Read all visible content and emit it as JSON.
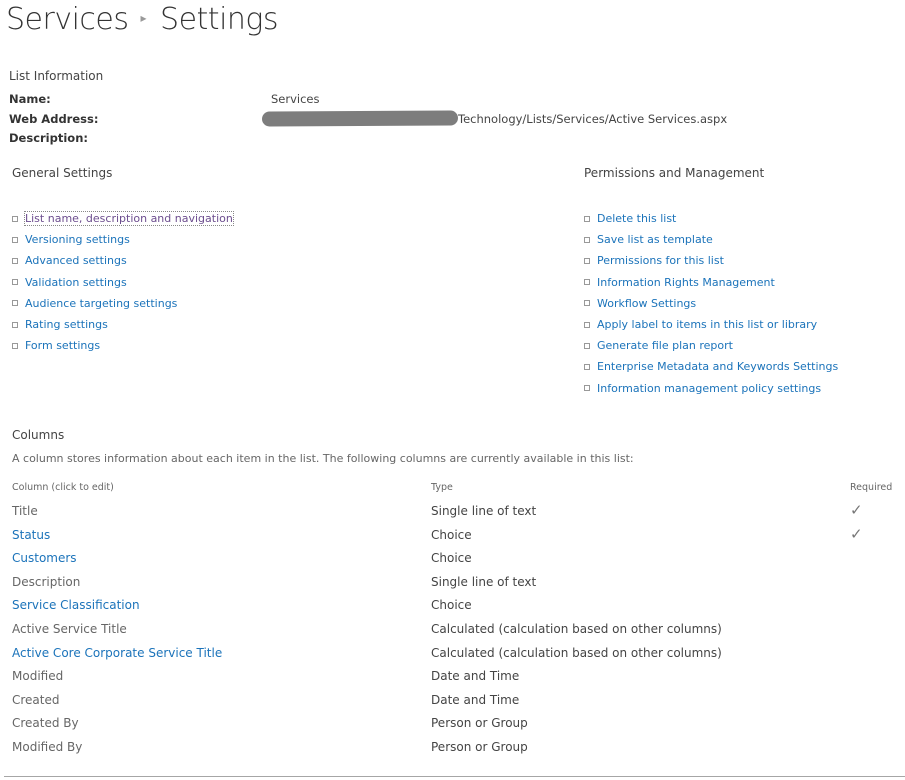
{
  "header": {
    "breadcrumb_parent": "Services",
    "breadcrumb_separator": "▸",
    "page_title": "Settings"
  },
  "list_information": {
    "heading": "List Information",
    "name_label": "Name:",
    "name_value": "Services",
    "web_address_label": "Web Address:",
    "web_address_value_visible": "Technology/Lists/Services/Active Services.aspx",
    "description_label": "Description:",
    "description_value": ""
  },
  "general_settings": {
    "heading": "General Settings",
    "links": [
      {
        "label": "List name, description and navigation",
        "focused": true
      },
      {
        "label": "Versioning settings"
      },
      {
        "label": "Advanced settings"
      },
      {
        "label": "Validation settings"
      },
      {
        "label": "Audience targeting settings"
      },
      {
        "label": "Rating settings"
      },
      {
        "label": "Form settings"
      }
    ]
  },
  "permissions_management": {
    "heading": "Permissions and Management",
    "links": [
      {
        "label": "Delete this list"
      },
      {
        "label": "Save list as template"
      },
      {
        "label": "Permissions for this list"
      },
      {
        "label": "Information Rights Management"
      },
      {
        "label": "Workflow Settings"
      },
      {
        "label": "Apply label to items in this list or library"
      },
      {
        "label": "Generate file plan report"
      },
      {
        "label": "Enterprise Metadata and Keywords Settings"
      },
      {
        "label": "Information management policy settings"
      }
    ]
  },
  "columns": {
    "heading": "Columns",
    "description": "A column stores information about each item in the list. The following columns are currently available in this list:",
    "headers": {
      "column": "Column (click to edit)",
      "type": "Type",
      "required": "Required"
    },
    "check_glyph": "✓",
    "rows": [
      {
        "name": "Title",
        "type": "Single line of text",
        "required": true,
        "link": false
      },
      {
        "name": "Status",
        "type": "Choice",
        "required": true,
        "link": true
      },
      {
        "name": "Customers",
        "type": "Choice",
        "required": false,
        "link": true
      },
      {
        "name": "Description",
        "type": "Single line of text",
        "required": false,
        "link": false
      },
      {
        "name": "Service Classification",
        "type": "Choice",
        "required": false,
        "link": true
      },
      {
        "name": "Active Service Title",
        "type": "Calculated (calculation based on other columns)",
        "required": false,
        "link": false
      },
      {
        "name": "Active Core Corporate Service Title",
        "type": "Calculated (calculation based on other columns)",
        "required": false,
        "link": true
      },
      {
        "name": "Modified",
        "type": "Date and Time",
        "required": false,
        "link": false
      },
      {
        "name": "Created",
        "type": "Date and Time",
        "required": false,
        "link": false
      },
      {
        "name": "Created By",
        "type": "Person or Group",
        "required": false,
        "link": false
      },
      {
        "name": "Modified By",
        "type": "Person or Group",
        "required": false,
        "link": false
      }
    ]
  },
  "colors": {
    "link": "#1b73ba",
    "visited_link": "#6c4d8e",
    "text": "#444444",
    "muted": "#666666"
  }
}
